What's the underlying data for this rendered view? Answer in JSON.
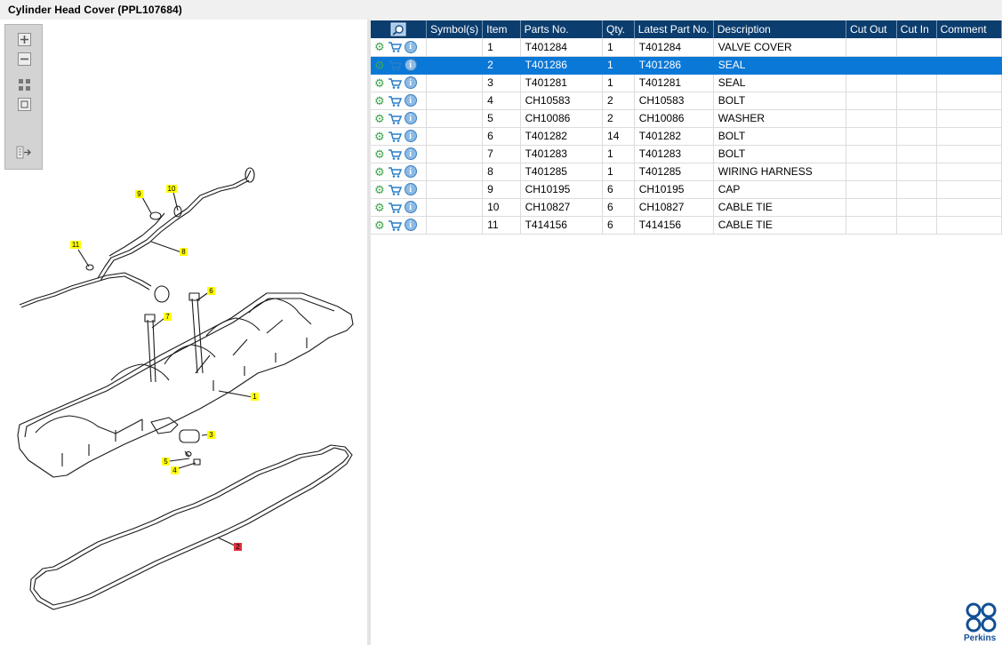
{
  "window": {
    "title": "Cylinder Head Cover (PPL107684)"
  },
  "zoom_toolbar": {
    "buttons": [
      "zoom-in-icon",
      "zoom-out-icon",
      "fit-all-icon",
      "actual-size-icon",
      "export-icon"
    ]
  },
  "diagram": {
    "callouts": [
      {
        "label": "1",
        "style": "yellow"
      },
      {
        "label": "2",
        "style": "red"
      },
      {
        "label": "3",
        "style": "yellow"
      },
      {
        "label": "4",
        "style": "yellow"
      },
      {
        "label": "5",
        "style": "yellow"
      },
      {
        "label": "6",
        "style": "yellow"
      },
      {
        "label": "7",
        "style": "yellow"
      },
      {
        "label": "8",
        "style": "yellow"
      },
      {
        "label": "9",
        "style": "yellow"
      },
      {
        "label": "10",
        "style": "yellow"
      },
      {
        "label": "11",
        "style": "yellow"
      }
    ]
  },
  "table": {
    "columns": [
      "Symbol(s)",
      "Item",
      "Parts No.",
      "Qty.",
      "Latest Part No.",
      "Description",
      "Cut Out",
      "Cut In",
      "Comment"
    ],
    "rows": [
      {
        "item": "1",
        "part_no": "T401284",
        "qty": "1",
        "latest": "T401284",
        "desc": "VALVE COVER"
      },
      {
        "item": "2",
        "part_no": "T401286",
        "qty": "1",
        "latest": "T401286",
        "desc": "SEAL"
      },
      {
        "item": "3",
        "part_no": "T401281",
        "qty": "1",
        "latest": "T401281",
        "desc": "SEAL"
      },
      {
        "item": "4",
        "part_no": "CH10583",
        "qty": "2",
        "latest": "CH10583",
        "desc": "BOLT"
      },
      {
        "item": "5",
        "part_no": "CH10086",
        "qty": "2",
        "latest": "CH10086",
        "desc": "WASHER"
      },
      {
        "item": "6",
        "part_no": "T401282",
        "qty": "14",
        "latest": "T401282",
        "desc": "BOLT"
      },
      {
        "item": "7",
        "part_no": "T401283",
        "qty": "1",
        "latest": "T401283",
        "desc": "BOLT"
      },
      {
        "item": "8",
        "part_no": "T401285",
        "qty": "1",
        "latest": "T401285",
        "desc": "WIRING HARNESS"
      },
      {
        "item": "9",
        "part_no": "CH10195",
        "qty": "6",
        "latest": "CH10195",
        "desc": "CAP"
      },
      {
        "item": "10",
        "part_no": "CH10827",
        "qty": "6",
        "latest": "CH10827",
        "desc": "CABLE TIE"
      },
      {
        "item": "11",
        "part_no": "T414156",
        "qty": "6",
        "latest": "T414156",
        "desc": "CABLE TIE"
      }
    ],
    "selected_item": "2"
  },
  "brand": {
    "name": "Perkins",
    "color": "#124f96"
  },
  "colors": {
    "header": "#0b3d6e",
    "selection": "#0a78d7",
    "callout_yellow": "#ffff00",
    "callout_red": "#e0323c"
  }
}
